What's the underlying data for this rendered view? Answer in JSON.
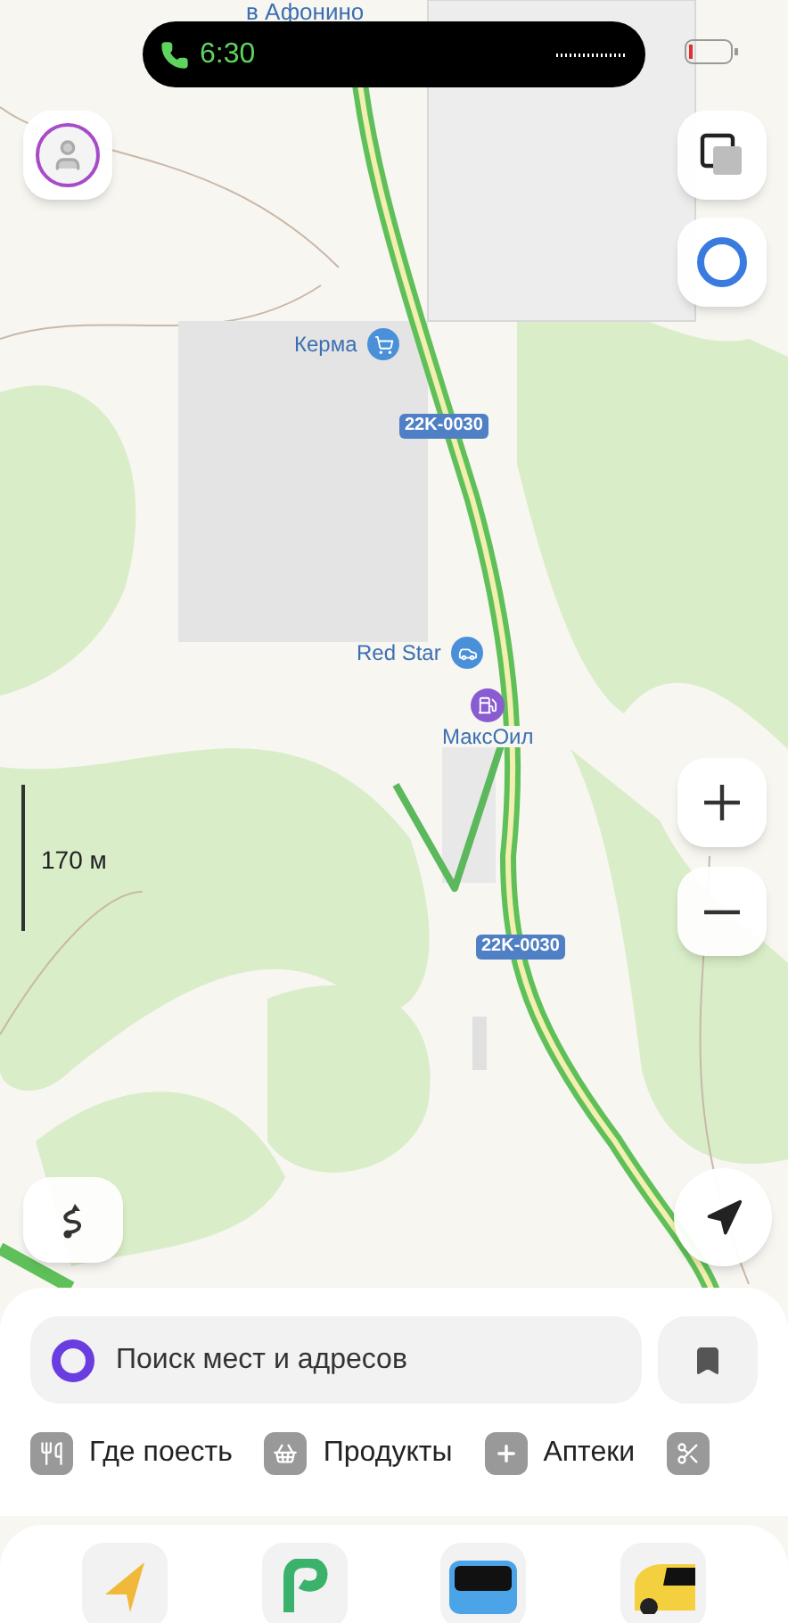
{
  "status_bar": {
    "time": "6:30"
  },
  "map": {
    "labels": [
      {
        "text": "в Афонино",
        "kind": "place"
      },
      {
        "text": "Керма",
        "kind": "poi"
      },
      {
        "text": "22K-0030",
        "kind": "road"
      },
      {
        "text": "Red Star",
        "kind": "poi"
      },
      {
        "text": "МаксОил",
        "kind": "poi"
      },
      {
        "text": "22K-0030",
        "kind": "road"
      }
    ],
    "scale": "170 м"
  },
  "search": {
    "placeholder": "Поиск мест и адресов"
  },
  "categories": [
    {
      "label": "Где поесть"
    },
    {
      "label": "Продукты"
    },
    {
      "label": "Аптеки"
    }
  ]
}
